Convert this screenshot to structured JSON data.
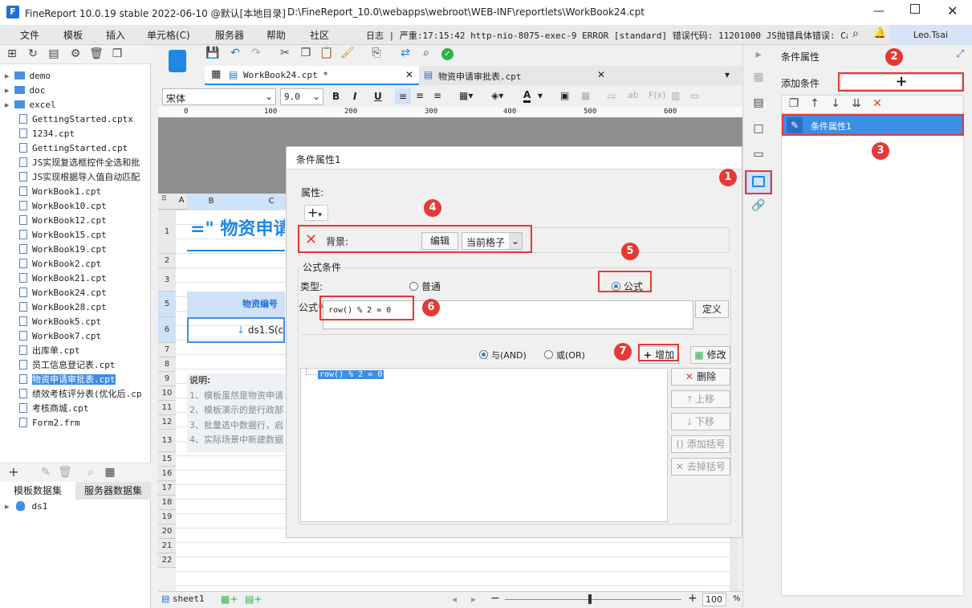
{
  "titlebar": {
    "title": "FineReport 10.0.19 stable 2022-06-10 @默认[本地目录]",
    "path": "D:\\FineReport_10.0\\webapps\\webroot\\WEB-INF\\reportlets\\WorkBook24.cpt"
  },
  "menu": [
    "文件",
    "模板",
    "插入",
    "单元格(C)",
    "服务器",
    "帮助",
    "社区"
  ],
  "log": "日志 | 严重:17:15:42 http-nio-8075-exec-9 ERROR [standard] 错误代码: 11201000 JS抛错具体错误: Can...",
  "user": "Leo.Tsai",
  "file_tree": [
    {
      "name": "demo",
      "type": "folder"
    },
    {
      "name": "doc",
      "type": "folder"
    },
    {
      "name": "excel",
      "type": "folder"
    },
    {
      "name": "GettingStarted.cptx",
      "type": "file"
    },
    {
      "name": "1234.cpt",
      "type": "file"
    },
    {
      "name": "GettingStarted.cpt",
      "type": "file"
    },
    {
      "name": "JS实现复选框控件全选和批",
      "type": "file"
    },
    {
      "name": "JS实现根据导入值自动匹配",
      "type": "file"
    },
    {
      "name": "WorkBook1.cpt",
      "type": "file"
    },
    {
      "name": "WorkBook10.cpt",
      "type": "file"
    },
    {
      "name": "WorkBook12.cpt",
      "type": "file"
    },
    {
      "name": "WorkBook15.cpt",
      "type": "file"
    },
    {
      "name": "WorkBook19.cpt",
      "type": "file"
    },
    {
      "name": "WorkBook2.cpt",
      "type": "file"
    },
    {
      "name": "WorkBook21.cpt",
      "type": "file"
    },
    {
      "name": "WorkBook24.cpt",
      "type": "file"
    },
    {
      "name": "WorkBook28.cpt",
      "type": "file"
    },
    {
      "name": "WorkBook5.cpt",
      "type": "file"
    },
    {
      "name": "WorkBook7.cpt",
      "type": "file"
    },
    {
      "name": "出库单.cpt",
      "type": "file"
    },
    {
      "name": "员工信息登记表.cpt",
      "type": "file"
    },
    {
      "name": "物资申请审批表.cpt",
      "type": "file",
      "selected": true
    },
    {
      "name": "绩效考核评分表(优化后.cp",
      "type": "file"
    },
    {
      "name": "考核商城.cpt",
      "type": "file"
    },
    {
      "name": "Form2.frm",
      "type": "file"
    }
  ],
  "dataset_tabs": [
    "模板数据集",
    "服务器数据集"
  ],
  "dataset": "ds1",
  "tabs": [
    "WorkBook24.cpt *",
    "物资申请审批表.cpt"
  ],
  "font": {
    "name": "宋体",
    "size": "9.0"
  },
  "ruler": [
    "0",
    "100",
    "200",
    "300",
    "400",
    "500",
    "600"
  ],
  "columns": [
    "A",
    "B",
    "C"
  ],
  "rows": [
    "1",
    "2",
    "3",
    "5",
    "6",
    "7",
    "8",
    "9",
    "10",
    "11",
    "12",
    "13",
    "15",
    "16",
    "17",
    "18",
    "19",
    "20",
    "21",
    "22"
  ],
  "sheet": {
    "title": "=\" 物资申请",
    "header_cell": "物资编号",
    "data_cell": "ds1.S(co",
    "notes_title": "说明:",
    "notes": [
      "1、模板虽然是物资申请",
      "2、模板演示的是行政部",
      "3、批量选中数据行，启",
      "4、实际场景中新建数据"
    ]
  },
  "sheet_tab": "sheet1",
  "zoom": "100",
  "zoom_unit": "%",
  "dialog": {
    "title": "条件属性1",
    "attr_label": "属性:",
    "bg_label": "背景:",
    "edit": "编辑",
    "current_cell": "当前格子",
    "formula_cond": "公式条件",
    "type_label": "类型:",
    "normal": "普通",
    "formula": "公式",
    "formula_label": "公式",
    "formula_value": "row() % 2 = 0",
    "define": "定义",
    "and": "与(AND)",
    "or": "或(OR)",
    "add": "增加",
    "modify": "修改",
    "delete": "删除",
    "up": "上移",
    "down": "下移",
    "add_bracket": "添加括号",
    "remove_bracket": "去掉括号",
    "list_item": "row() % 2 = 0"
  },
  "right_panel": {
    "title": "条件属性",
    "add_cond": "添加条件",
    "item": "条件属性1"
  },
  "badges": [
    "1",
    "2",
    "3",
    "4",
    "5",
    "6",
    "7"
  ],
  "colors": {
    "accent": "#1e88e5",
    "annotation": "#e53935",
    "selection": "#3d8ee6"
  }
}
